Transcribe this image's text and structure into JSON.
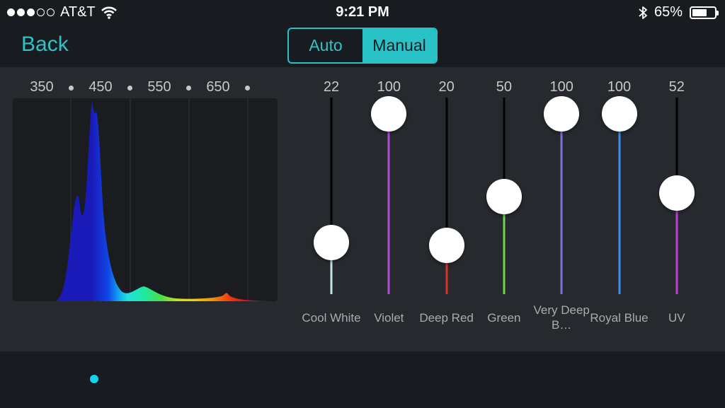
{
  "status_bar": {
    "carrier": "AT&T",
    "time": "9:21 PM",
    "battery": "65%",
    "battery_level": 0.65,
    "signal_icon": "signal-dots-icon",
    "wifi_icon": "wifi-icon",
    "bluetooth_icon": "bluetooth-icon"
  },
  "nav": {
    "back_label": "Back",
    "modes": [
      {
        "label": "Auto",
        "selected": false
      },
      {
        "label": "Manual",
        "selected": true
      }
    ]
  },
  "spectrum": {
    "ticks": [
      "350",
      "450",
      "550",
      "650"
    ]
  },
  "channels": [
    {
      "name": "Cool White",
      "value": "22",
      "level": 0.22,
      "color": "#bfe3e6"
    },
    {
      "name": "Violet",
      "value": "100",
      "level": 1.0,
      "color": "#b24ad8"
    },
    {
      "name": "Deep Red",
      "value": "20",
      "level": 0.2,
      "color": "#d8332c"
    },
    {
      "name": "Green",
      "value": "50",
      "level": 0.5,
      "color": "#6fd94e"
    },
    {
      "name": "Very Deep B…",
      "value": "100",
      "level": 1.0,
      "color": "#7a72d8"
    },
    {
      "name": "Royal Blue",
      "value": "100",
      "level": 1.0,
      "color": "#3c8ff0"
    },
    {
      "name": "UV",
      "value": "52",
      "level": 0.52,
      "color": "#c33ad8"
    }
  ],
  "colors": {
    "accent": "#29c2c7",
    "page_indicator": "#11d3ec"
  }
}
